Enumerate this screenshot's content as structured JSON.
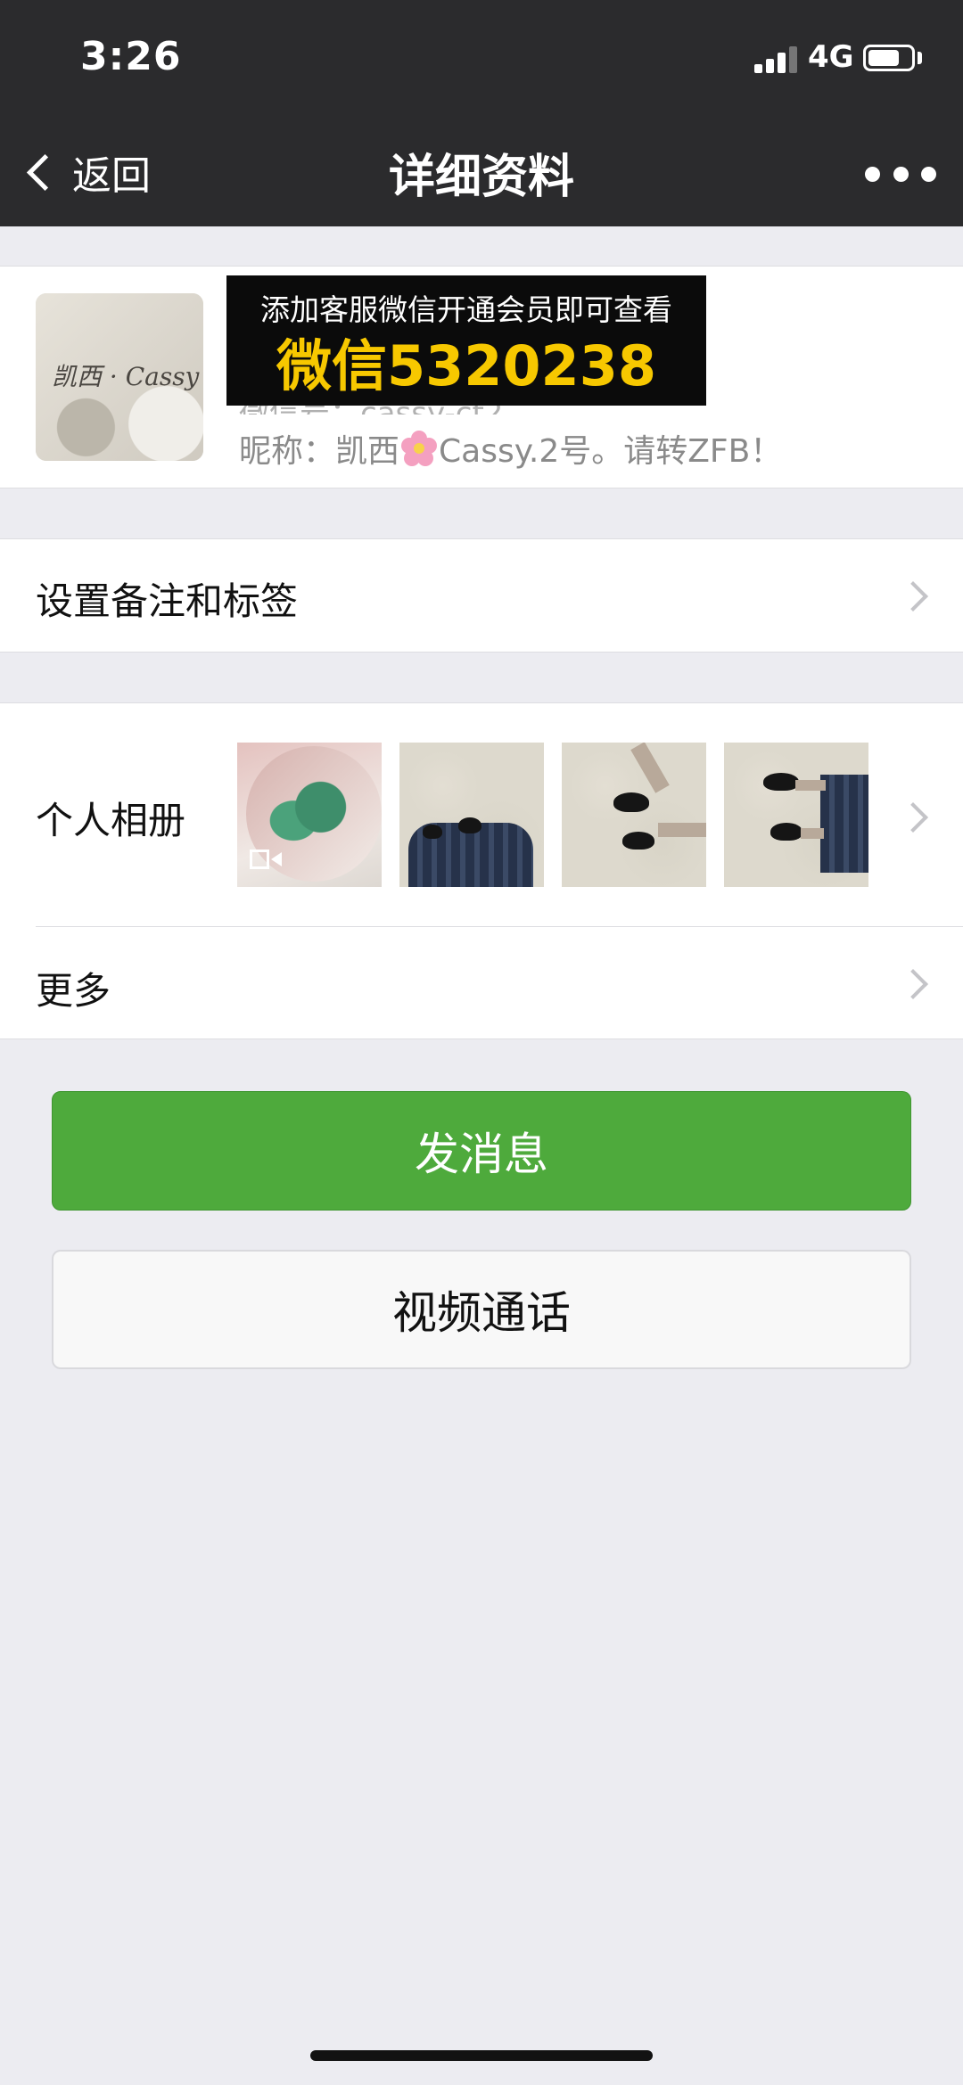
{
  "status_bar": {
    "time": "3:26",
    "network": "4G",
    "signal_bars_active": 3,
    "battery_level": 0.65
  },
  "nav": {
    "back_label": "返回",
    "title": "详细资料",
    "more_icon": "more-dots-icon"
  },
  "profile": {
    "avatar_text": "凯西 · Cassy",
    "promo_line1": "添加客服微信开通会员即可查看",
    "promo_line2": "微信5320238",
    "wechat_id_partial": "微信号：cassy-ct2",
    "nickname_prefix": "昵称：凯西",
    "nickname_suffix": "Cassy.2号。请转ZFB！"
  },
  "rows": {
    "remark": "设置备注和标签",
    "album": "个人相册",
    "more": "更多"
  },
  "buttons": {
    "send_message": "发消息",
    "video_call": "视频通话"
  },
  "colors": {
    "header_bg": "#2b2b2d",
    "page_bg": "#ececf1",
    "primary_green": "#4eaa3c",
    "promo_yellow": "#f7c800"
  }
}
